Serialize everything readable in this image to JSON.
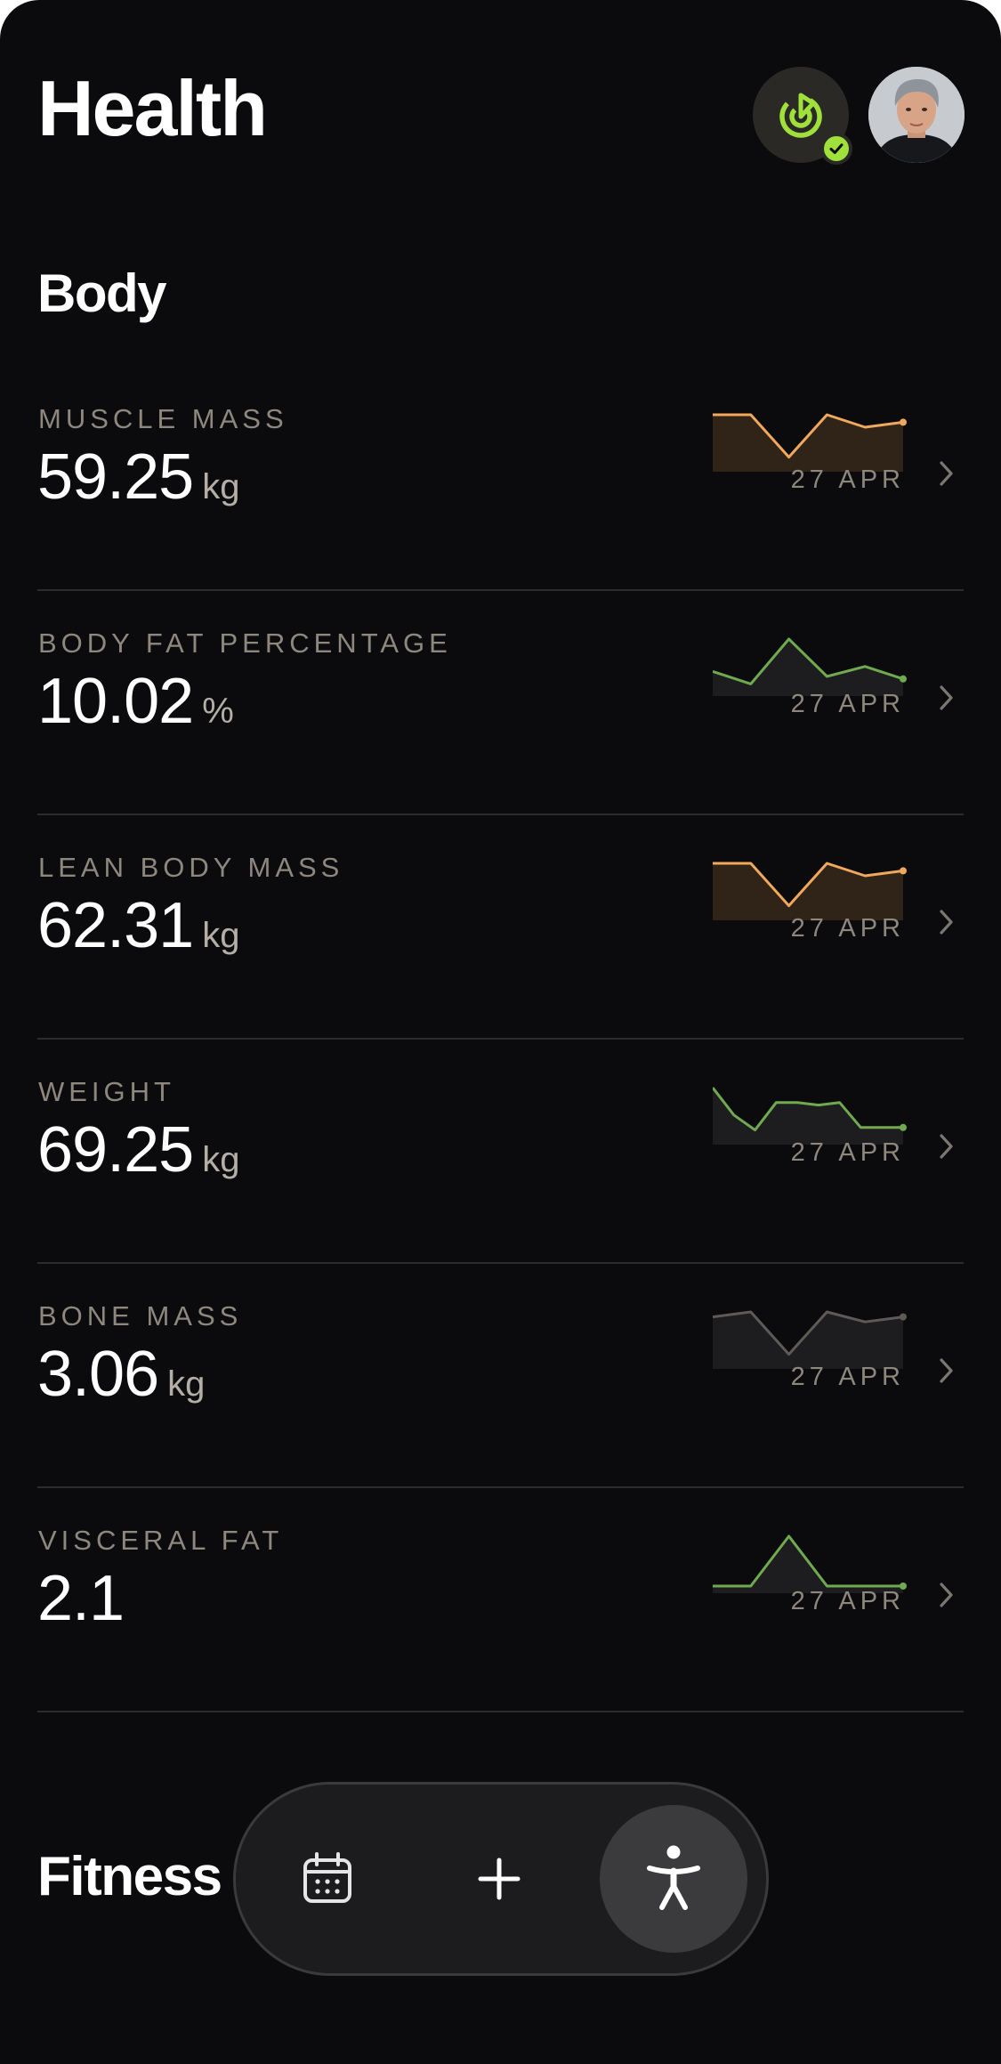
{
  "header": {
    "title": "Health",
    "sync_icon": "sync-target-icon",
    "sync_badge_icon": "checkmark-icon",
    "accent_color": "#9fe03a"
  },
  "sections": {
    "body_title": "Body",
    "fitness_title": "Fitness"
  },
  "metrics": [
    {
      "label": "MUSCLE MASS",
      "value": "59.25",
      "unit": "kg",
      "date": "27 APR",
      "trend_color": "#f0a95c",
      "trend": [
        1,
        1,
        0.15,
        1,
        0.75,
        0.85
      ]
    },
    {
      "label": "BODY FAT PERCENTAGE",
      "value": "10.02",
      "unit": "%",
      "date": "27 APR",
      "trend_color": "#6faa4e",
      "trend": [
        0.35,
        0.1,
        1,
        0.25,
        0.45,
        0.2
      ]
    },
    {
      "label": "LEAN BODY MASS",
      "value": "62.31",
      "unit": "kg",
      "date": "27 APR",
      "trend_color": "#f0a95c",
      "trend": [
        1,
        1,
        0.15,
        1,
        0.75,
        0.85
      ]
    },
    {
      "label": "WEIGHT",
      "value": "69.25",
      "unit": "kg",
      "date": "27 APR",
      "trend_color": "#6faa4e",
      "trend": [
        1,
        0.45,
        0.15,
        0.7,
        0.7,
        0.65,
        0.7,
        0.2,
        0.2,
        0.2
      ]
    },
    {
      "label": "BONE MASS",
      "value": "3.06",
      "unit": "kg",
      "date": "27 APR",
      "trend_color": "#5e5b57",
      "trend": [
        0.9,
        1,
        0.15,
        1,
        0.8,
        0.9
      ]
    },
    {
      "label": "VISCERAL FAT",
      "value": "2.1",
      "unit": "",
      "date": "27 APR",
      "trend_color": "#6faa4e",
      "trend": [
        0,
        0,
        1,
        0,
        0,
        0
      ]
    }
  ],
  "tabbar": {
    "items": [
      {
        "name": "tab-calendar",
        "icon": "calendar-icon"
      },
      {
        "name": "tab-add",
        "icon": "plus-icon"
      },
      {
        "name": "tab-body",
        "icon": "accessibility-figure-icon",
        "selected": true
      }
    ]
  }
}
